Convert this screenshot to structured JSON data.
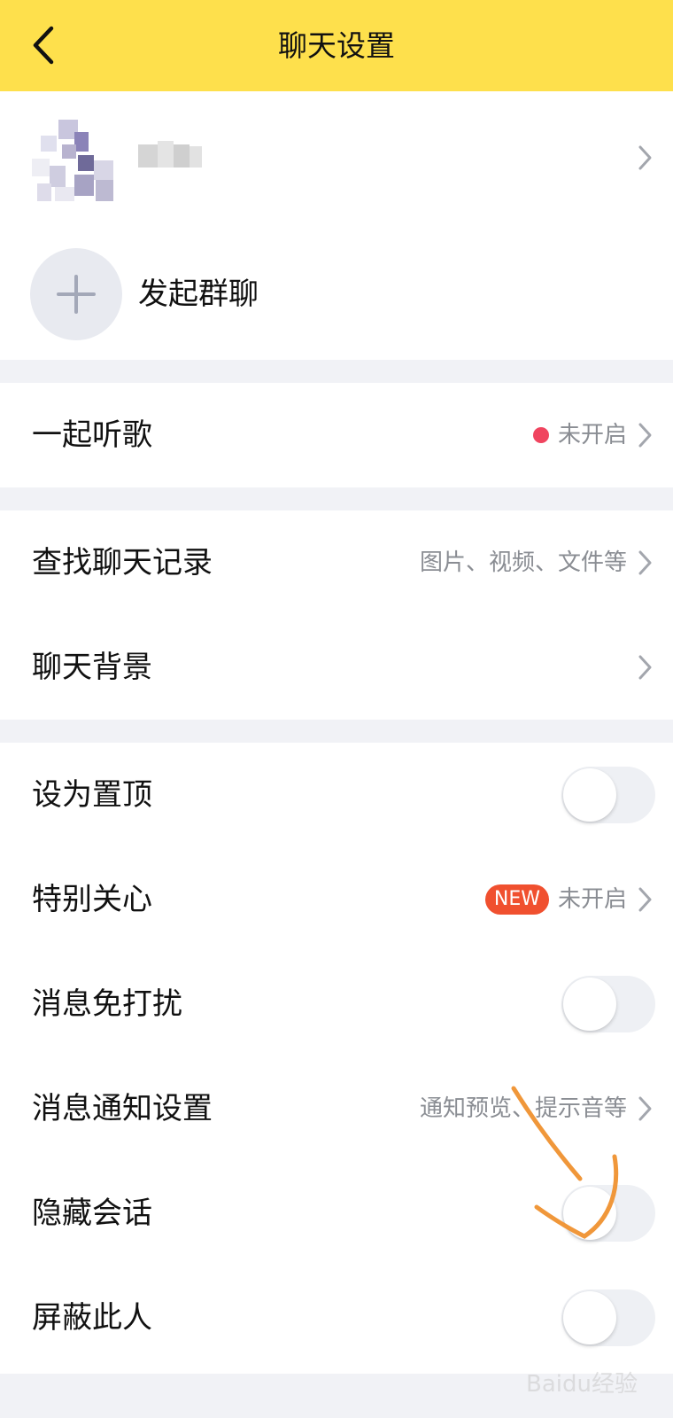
{
  "header": {
    "title": "聊天设置",
    "back_icon": "chevron-left-icon"
  },
  "profile": {
    "avatar_icon": "pixelated-avatar",
    "name_icon": "pixelated-name"
  },
  "group_chat": {
    "label": "发起群聊",
    "icon": "plus-icon"
  },
  "listen_together": {
    "label": "一起听歌",
    "status": "未开启",
    "dot_color": "#f0445f"
  },
  "search_history": {
    "label": "查找聊天记录",
    "hint": "图片、视频、文件等"
  },
  "background": {
    "label": "聊天背景"
  },
  "settings": {
    "pin": {
      "label": "设为置顶",
      "enabled": false
    },
    "special_care": {
      "label": "特别关心",
      "badge": "NEW",
      "status": "未开启"
    },
    "dnd": {
      "label": "消息免打扰",
      "enabled": false
    },
    "notify": {
      "label": "消息通知设置",
      "hint": "通知预览、提示音等"
    },
    "hide_chat": {
      "label": "隐藏会话",
      "enabled": false
    },
    "block": {
      "label": "屏蔽此人",
      "enabled": false
    }
  },
  "colors": {
    "header_bg": "#fee04c",
    "annotation": "#f0973a"
  },
  "watermark": "Baidu经验"
}
